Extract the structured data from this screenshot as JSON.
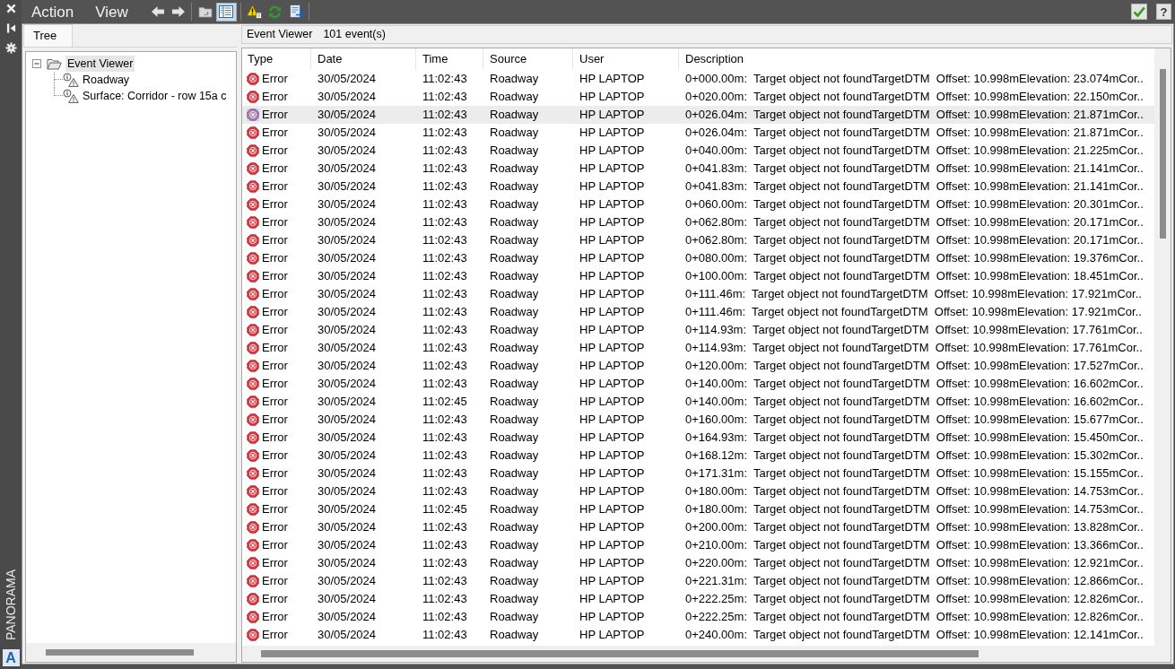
{
  "side_strip": {
    "label": "PANORAMA",
    "logo": "A"
  },
  "menu": [
    {
      "label": "Action"
    },
    {
      "label": "View"
    }
  ],
  "toolbar": {
    "tree_toggle_pressed": true
  },
  "help_button": {
    "label": "?"
  },
  "tabs": [
    {
      "label": "Tree",
      "selected": true
    }
  ],
  "tree": [
    {
      "label": "Event Viewer",
      "expanded": true,
      "selected": true,
      "children": [
        {
          "label": "Roadway",
          "selected": false
        },
        {
          "label": "Surface: Corridor - row 15a c",
          "selected": false
        }
      ]
    }
  ],
  "viewer": {
    "title": "Event Viewer",
    "count": "101 event(s)"
  },
  "table": {
    "columns": [
      "Type",
      "Date",
      "Time",
      "Source",
      "User",
      "Description"
    ],
    "rows": [
      {
        "type": "Error",
        "date": "30/05/2024",
        "time": "11:02:43",
        "source": "Roadway",
        "user": "HP LAPTOP",
        "description": "0+000.00m:  Target object not foundTargetDTM  Offset: 10.998mElevation: 23.074mCor..",
        "selected": false
      },
      {
        "type": "Error",
        "date": "30/05/2024",
        "time": "11:02:43",
        "source": "Roadway",
        "user": "HP LAPTOP",
        "description": "0+020.00m:  Target object not foundTargetDTM  Offset: 10.998mElevation: 22.150mCor..",
        "selected": false
      },
      {
        "type": "Error",
        "date": "30/05/2024",
        "time": "11:02:43",
        "source": "Roadway",
        "user": "HP LAPTOP",
        "description": "0+026.04m:  Target object not foundTargetDTM  Offset: 10.998mElevation: 21.871mCor..",
        "selected": true
      },
      {
        "type": "Error",
        "date": "30/05/2024",
        "time": "11:02:43",
        "source": "Roadway",
        "user": "HP LAPTOP",
        "description": "0+026.04m:  Target object not foundTargetDTM  Offset: 10.998mElevation: 21.871mCor..",
        "selected": false
      },
      {
        "type": "Error",
        "date": "30/05/2024",
        "time": "11:02:43",
        "source": "Roadway",
        "user": "HP LAPTOP",
        "description": "0+040.00m:  Target object not foundTargetDTM  Offset: 10.998mElevation: 21.225mCor..",
        "selected": false
      },
      {
        "type": "Error",
        "date": "30/05/2024",
        "time": "11:02:43",
        "source": "Roadway",
        "user": "HP LAPTOP",
        "description": "0+041.83m:  Target object not foundTargetDTM  Offset: 10.998mElevation: 21.141mCor..",
        "selected": false
      },
      {
        "type": "Error",
        "date": "30/05/2024",
        "time": "11:02:43",
        "source": "Roadway",
        "user": "HP LAPTOP",
        "description": "0+041.83m:  Target object not foundTargetDTM  Offset: 10.998mElevation: 21.141mCor..",
        "selected": false
      },
      {
        "type": "Error",
        "date": "30/05/2024",
        "time": "11:02:43",
        "source": "Roadway",
        "user": "HP LAPTOP",
        "description": "0+060.00m:  Target object not foundTargetDTM  Offset: 10.998mElevation: 20.301mCor..",
        "selected": false
      },
      {
        "type": "Error",
        "date": "30/05/2024",
        "time": "11:02:43",
        "source": "Roadway",
        "user": "HP LAPTOP",
        "description": "0+062.80m:  Target object not foundTargetDTM  Offset: 10.998mElevation: 20.171mCor..",
        "selected": false
      },
      {
        "type": "Error",
        "date": "30/05/2024",
        "time": "11:02:43",
        "source": "Roadway",
        "user": "HP LAPTOP",
        "description": "0+062.80m:  Target object not foundTargetDTM  Offset: 10.998mElevation: 20.171mCor..",
        "selected": false
      },
      {
        "type": "Error",
        "date": "30/05/2024",
        "time": "11:02:43",
        "source": "Roadway",
        "user": "HP LAPTOP",
        "description": "0+080.00m:  Target object not foundTargetDTM  Offset: 10.998mElevation: 19.376mCor..",
        "selected": false
      },
      {
        "type": "Error",
        "date": "30/05/2024",
        "time": "11:02:43",
        "source": "Roadway",
        "user": "HP LAPTOP",
        "description": "0+100.00m:  Target object not foundTargetDTM  Offset: 10.998mElevation: 18.451mCor..",
        "selected": false
      },
      {
        "type": "Error",
        "date": "30/05/2024",
        "time": "11:02:43",
        "source": "Roadway",
        "user": "HP LAPTOP",
        "description": "0+111.46m:  Target object not foundTargetDTM  Offset: 10.998mElevation: 17.921mCor..",
        "selected": false
      },
      {
        "type": "Error",
        "date": "30/05/2024",
        "time": "11:02:43",
        "source": "Roadway",
        "user": "HP LAPTOP",
        "description": "0+111.46m:  Target object not foundTargetDTM  Offset: 10.998mElevation: 17.921mCor..",
        "selected": false
      },
      {
        "type": "Error",
        "date": "30/05/2024",
        "time": "11:02:43",
        "source": "Roadway",
        "user": "HP LAPTOP",
        "description": "0+114.93m:  Target object not foundTargetDTM  Offset: 10.998mElevation: 17.761mCor..",
        "selected": false
      },
      {
        "type": "Error",
        "date": "30/05/2024",
        "time": "11:02:43",
        "source": "Roadway",
        "user": "HP LAPTOP",
        "description": "0+114.93m:  Target object not foundTargetDTM  Offset: 10.998mElevation: 17.761mCor..",
        "selected": false
      },
      {
        "type": "Error",
        "date": "30/05/2024",
        "time": "11:02:43",
        "source": "Roadway",
        "user": "HP LAPTOP",
        "description": "0+120.00m:  Target object not foundTargetDTM  Offset: 10.998mElevation: 17.527mCor..",
        "selected": false
      },
      {
        "type": "Error",
        "date": "30/05/2024",
        "time": "11:02:43",
        "source": "Roadway",
        "user": "HP LAPTOP",
        "description": "0+140.00m:  Target object not foundTargetDTM  Offset: 10.998mElevation: 16.602mCor..",
        "selected": false
      },
      {
        "type": "Error",
        "date": "30/05/2024",
        "time": "11:02:45",
        "source": "Roadway",
        "user": "HP LAPTOP",
        "description": "0+140.00m:  Target object not foundTargetDTM  Offset: 10.998mElevation: 16.602mCor..",
        "selected": false
      },
      {
        "type": "Error",
        "date": "30/05/2024",
        "time": "11:02:43",
        "source": "Roadway",
        "user": "HP LAPTOP",
        "description": "0+160.00m:  Target object not foundTargetDTM  Offset: 10.998mElevation: 15.677mCor..",
        "selected": false
      },
      {
        "type": "Error",
        "date": "30/05/2024",
        "time": "11:02:43",
        "source": "Roadway",
        "user": "HP LAPTOP",
        "description": "0+164.93m:  Target object not foundTargetDTM  Offset: 10.998mElevation: 15.450mCor..",
        "selected": false
      },
      {
        "type": "Error",
        "date": "30/05/2024",
        "time": "11:02:43",
        "source": "Roadway",
        "user": "HP LAPTOP",
        "description": "0+168.12m:  Target object not foundTargetDTM  Offset: 10.998mElevation: 15.302mCor..",
        "selected": false
      },
      {
        "type": "Error",
        "date": "30/05/2024",
        "time": "11:02:43",
        "source": "Roadway",
        "user": "HP LAPTOP",
        "description": "0+171.31m:  Target object not foundTargetDTM  Offset: 10.998mElevation: 15.155mCor..",
        "selected": false
      },
      {
        "type": "Error",
        "date": "30/05/2024",
        "time": "11:02:43",
        "source": "Roadway",
        "user": "HP LAPTOP",
        "description": "0+180.00m:  Target object not foundTargetDTM  Offset: 10.998mElevation: 14.753mCor..",
        "selected": false
      },
      {
        "type": "Error",
        "date": "30/05/2024",
        "time": "11:02:45",
        "source": "Roadway",
        "user": "HP LAPTOP",
        "description": "0+180.00m:  Target object not foundTargetDTM  Offset: 10.998mElevation: 14.753mCor..",
        "selected": false
      },
      {
        "type": "Error",
        "date": "30/05/2024",
        "time": "11:02:43",
        "source": "Roadway",
        "user": "HP LAPTOP",
        "description": "0+200.00m:  Target object not foundTargetDTM  Offset: 10.998mElevation: 13.828mCor..",
        "selected": false
      },
      {
        "type": "Error",
        "date": "30/05/2024",
        "time": "11:02:43",
        "source": "Roadway",
        "user": "HP LAPTOP",
        "description": "0+210.00m:  Target object not foundTargetDTM  Offset: 10.998mElevation: 13.366mCor..",
        "selected": false
      },
      {
        "type": "Error",
        "date": "30/05/2024",
        "time": "11:02:43",
        "source": "Roadway",
        "user": "HP LAPTOP",
        "description": "0+220.00m:  Target object not foundTargetDTM  Offset: 10.998mElevation: 12.921mCor..",
        "selected": false
      },
      {
        "type": "Error",
        "date": "30/05/2024",
        "time": "11:02:43",
        "source": "Roadway",
        "user": "HP LAPTOP",
        "description": "0+221.31m:  Target object not foundTargetDTM  Offset: 10.998mElevation: 12.866mCor..",
        "selected": false
      },
      {
        "type": "Error",
        "date": "30/05/2024",
        "time": "11:02:43",
        "source": "Roadway",
        "user": "HP LAPTOP",
        "description": "0+222.25m:  Target object not foundTargetDTM  Offset: 10.998mElevation: 12.826mCor..",
        "selected": false
      },
      {
        "type": "Error",
        "date": "30/05/2024",
        "time": "11:02:43",
        "source": "Roadway",
        "user": "HP LAPTOP",
        "description": "0+222.25m:  Target object not foundTargetDTM  Offset: 10.998mElevation: 12.826mCor..",
        "selected": false
      },
      {
        "type": "Error",
        "date": "30/05/2024",
        "time": "11:02:43",
        "source": "Roadway",
        "user": "HP LAPTOP",
        "description": "0+240.00m:  Target object not foundTargetDTM  Offset: 10.998mElevation: 12.141mCor..",
        "selected": false
      }
    ]
  }
}
